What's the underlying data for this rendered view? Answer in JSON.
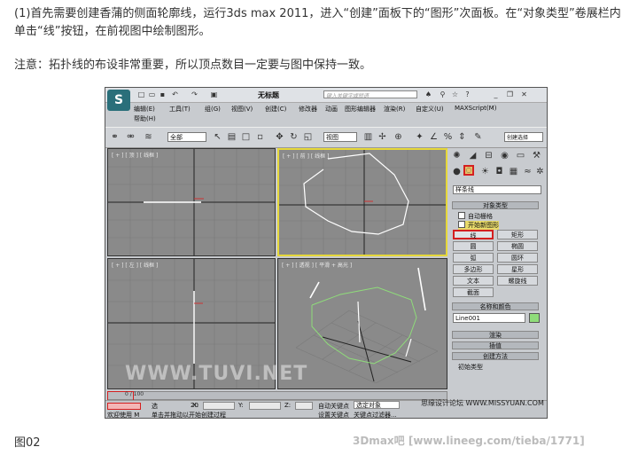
{
  "text": {
    "p1": "(1)首先需要创建香蒲的侧面轮廓线，运行3ds max 2011，进入“创建”面板下的“图形”次面板。在“对象类型”卷展栏内单击“线”按钮，在前视图中绘制图形。",
    "p2": "注意：拓扑线的布设非常重要，所以顶点数目一定要与图中保持一致。",
    "caption": "图02",
    "footer": "3Dmax吧  [www.lineeg.com/tieba/1771]"
  },
  "app": {
    "title": "无标题",
    "search_placeholder": "键入关键字或短语",
    "menus": [
      "编辑(E)",
      "工具(T)",
      "组(G)",
      "视图(V)",
      "创建(C)",
      "修改器",
      "动画",
      "图形编辑器",
      "渲染(R)",
      "自定义(U)",
      "MAXScript(M)",
      "帮助(H)"
    ],
    "toolbar": {
      "selection_filter": "全部",
      "ref_coord": "视图",
      "named_sel": "创建选择"
    },
    "viewports": [
      {
        "label": "[ + ] [ 顶 ] [ 线框 ]"
      },
      {
        "label": "[ + ] [ 前 ] [ 线框 ]"
      },
      {
        "label": "[ + ] [ 左 ] [ 线框 ]"
      },
      {
        "label": "[ + ] [ 透视 ] [ 平滑 + 高光 ]"
      }
    ],
    "panel": {
      "category": "样条线",
      "rollout_object_type": "对象类型",
      "auto_grid": "自动栅格",
      "start_new_shape": "开始新图形",
      "buttons": [
        "线",
        "矩形",
        "圆",
        "椭圆",
        "弧",
        "圆环",
        "多边形",
        "星形",
        "文本",
        "螺旋线",
        "截面"
      ],
      "rollout_name_color": "名称和颜色",
      "name_value": "Line001",
      "rollout_render": "渲染",
      "rollout_interp": "插值",
      "rollout_create_method": "创建方法",
      "initial_type": "初始类型",
      "colors": {
        "swatch": "#8fdc7a",
        "highlight": "#d42020",
        "active_viewport": "#e6d83a"
      }
    },
    "timeline": {
      "position": "0 / 100",
      "ticks": [
        "0",
        "10",
        "20",
        "30",
        "40",
        "50",
        "60",
        "70",
        "80",
        "90",
        "100"
      ]
    },
    "status": {
      "welcome": "欢迎使用 M",
      "prompt": "单击并拖动以开始创建过程",
      "select_label": "选",
      "x_label": "X:",
      "y_label": "Y:",
      "z_label": "Z:",
      "auto_key": "自动关键点",
      "auto_key_value": "选定对象",
      "set_key": "设置关键点",
      "key_filter": "关键点过滤器..."
    },
    "watermark": "思缘设计论坛  WWW.MISSYUAN.COM",
    "overlay_watermark": "WWW.TUVI.NET"
  }
}
